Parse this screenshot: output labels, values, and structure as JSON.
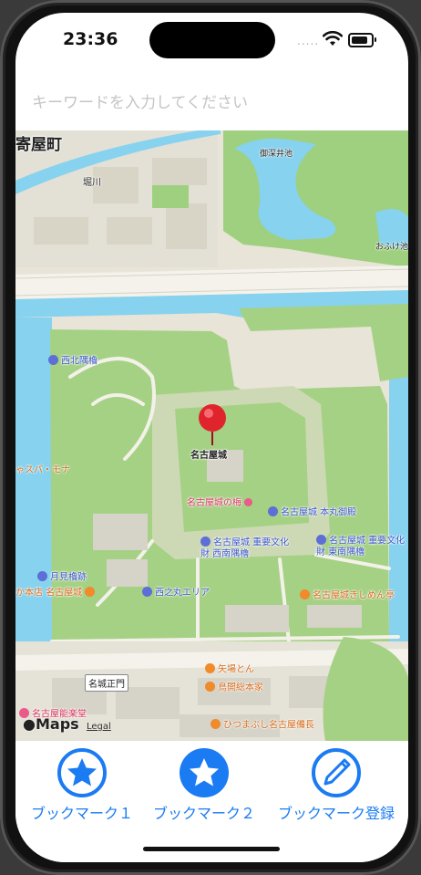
{
  "status_bar": {
    "time": "23:36",
    "signal": "....."
  },
  "search": {
    "placeholder": "キーワードを入力してください"
  },
  "map": {
    "pin_label": "名古屋城",
    "labels": {
      "kiyomachi": "寄屋町",
      "horikawa": "堀川",
      "gofukei": "御深井池",
      "ofukei": "おふけ池",
      "seihoku": "西北隅櫓",
      "spa": "ゃスパ・モナ",
      "castle_ume": "名古屋城の梅",
      "honmaru": "名古屋城 本丸御殿",
      "seinan": "名古屋城 重要文化財 西南隅櫓",
      "tonan": "名古屋城 重要文化財 東南隅櫓",
      "tsukimi": "月見櫓跡",
      "honten": "か本店 名古屋城",
      "ninomaru": "西之丸エリア",
      "kishimen": "名古屋城きしめん亭",
      "yabaton": "矢場とん",
      "torikai": "鳥開総本家",
      "gate": "名城正門",
      "nohgaku": "名古屋能楽堂",
      "hitsumabushi": "ひつまぶし名古屋備長"
    },
    "attribution": {
      "logo": "Maps",
      "legal": "Legal"
    }
  },
  "toolbar": {
    "items": [
      {
        "label": "ブックマーク１",
        "icon": "star-outline-icon"
      },
      {
        "label": "ブックマーク２",
        "icon": "star-filled-icon"
      },
      {
        "label": "ブックマーク登録",
        "icon": "pencil-icon"
      }
    ]
  },
  "colors": {
    "accent": "#1a7bf2",
    "water": "#86d2ef",
    "park": "#9fd07f"
  }
}
